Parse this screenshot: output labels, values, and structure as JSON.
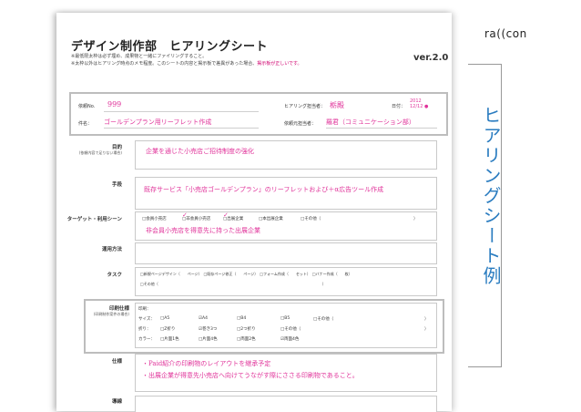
{
  "sheet": {
    "title": "デザイン制作部　ヒアリングシート",
    "version": "ver.2.0",
    "note1": "※最低限太枠は必ず埋め、成果物と一緒にファイリングすること。",
    "note2_a": "※太枠以外はヒアリング時点のメモ程度。このシートの内容と掲示板で差異があった場合、",
    "note2_b": "掲示板が正しいです。"
  },
  "header": {
    "request_no_label": "依頼No.",
    "request_no_value": "999",
    "hearing_person_label": "ヒアリング担当者：",
    "hearing_person_value": "栃殿",
    "date_label": "日付：",
    "date_value": "2012\n12/12 ●",
    "subject_label": "件名：",
    "subject_value": "ゴールデンプラン用リーフレット作成",
    "requester_label": "依頼元担当者：",
    "requester_value": "羅君（コミュニケーション部）"
  },
  "rows": {
    "purpose_label": "目的",
    "purpose_sub": "(依頼内容で足りない場合)",
    "purpose_value": "企業を通じた小売店ご招待制度の強化",
    "method_label": "手段",
    "method_value": "既存サービス「小売店ゴールデンプラン」のリーフレットおよび＋α広告ツール作成",
    "target_label": "ターゲット・利用シーン",
    "target_opt1": "□会員小売店",
    "target_opt2": "□非会員小売店",
    "target_opt3": "□出展企業",
    "target_opt4": "□本出展企業",
    "target_opt5": "□その他（",
    "target_close": "）",
    "target_value": "非会員小売店を得意先に持った出展企業",
    "usage_label": "運用方法",
    "task_label": "タスク",
    "task_line1": "□新規ページデザイン（　　ページ）　□既存ページ修正（　　ページ）　□フォーム作成（　　セット）　□バナー作成（　　枚）",
    "task_line2": "□その他（　　　　　　　　　　　　　　　　　　　　　　　　　　　　　　　　　　　　　　　　　　　　　）",
    "print_label": "印刷仕様",
    "print_sub": "(印刷制作案件の場合)",
    "print_row1": "印刷：",
    "print_size_label": "サイズ：",
    "print_size_opts": [
      "□A5",
      "☑A4",
      "□B4",
      "□B5",
      "□その他（",
      "）"
    ],
    "print_fold_label": "折り：",
    "print_fold_opts": [
      "□Z折り",
      "☑巻き3つ",
      "□2つ折り",
      "□その他（",
      "）"
    ],
    "print_color_label": "カラー：",
    "print_color_opts": [
      "□片面1色",
      "□片面4色",
      "□両面2色",
      "☑両面4色"
    ],
    "spec_label": "仕様",
    "spec_line1": "・Paid紹介の印刷物のレイアウトを継承予定",
    "spec_line2": "・出展企業が得意先小売店へ向けてうながす際にささる印刷物であること。",
    "delivery_label": "導線"
  },
  "side": {
    "vertical_text": "ヒアリングシート例",
    "logo": "ra((con"
  },
  "colors": {
    "accent_pink": "#e0339a",
    "side_blue": "#2a7cc0",
    "box_gray": "#bdbdbd"
  }
}
